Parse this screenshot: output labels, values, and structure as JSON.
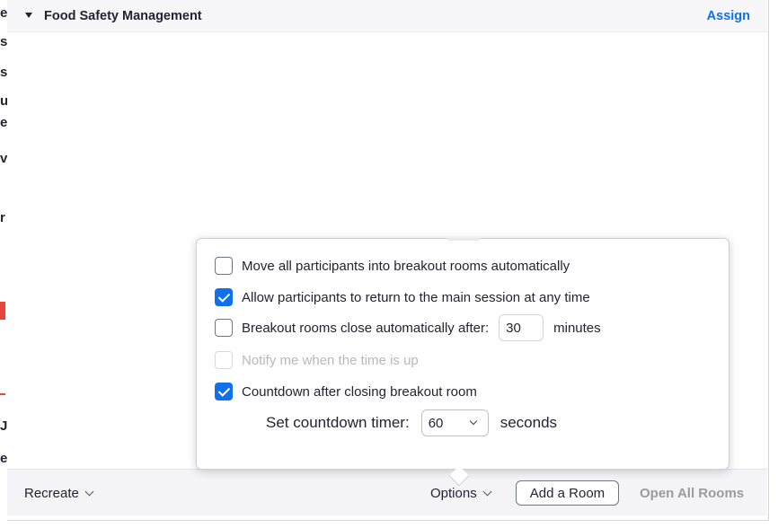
{
  "room": {
    "title": "Food Safety Management",
    "assign_label": "Assign"
  },
  "options_popup": {
    "move_all": {
      "label": "Move all participants into breakout rooms automatically",
      "checked": false
    },
    "allow_return": {
      "label": "Allow participants to return to the main session at any time",
      "checked": true
    },
    "auto_close": {
      "label": "Breakout rooms close automatically after:",
      "value": "30",
      "unit": "minutes",
      "checked": false
    },
    "notify": {
      "label": "Notify me when the time is up",
      "checked": false,
      "disabled": true
    },
    "countdown": {
      "label": "Countdown after closing breakout room",
      "checked": true
    },
    "timer": {
      "label": "Set countdown timer:",
      "value": "60",
      "unit": "seconds"
    }
  },
  "footer": {
    "recreate_label": "Recreate",
    "options_label": "Options",
    "add_room_label": "Add a Room",
    "open_all_label": "Open All Rooms"
  },
  "colors": {
    "accent": "#0e71eb",
    "disabled_text": "#b8b8bd"
  }
}
